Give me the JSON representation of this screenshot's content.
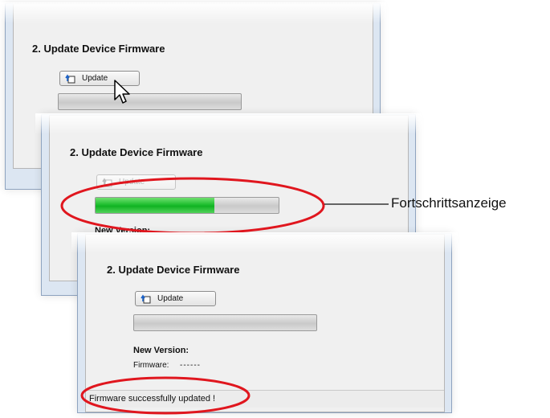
{
  "windows": [
    {
      "section_title": "2. Update Device Firmware",
      "update_label": "Update",
      "progress_fraction": 0
    },
    {
      "section_title": "2. Update Device Firmware",
      "update_label": "Update",
      "progress_fraction": 0.65,
      "new_version_label": "New Version:"
    },
    {
      "section_title": "2. Update Device Firmware",
      "update_label": "Update",
      "progress_fraction": 0,
      "new_version_label": "New Version:",
      "firmware_label": "Firmware:",
      "firmware_value": "------",
      "status_message": "Firmware successfully updated !"
    }
  ],
  "annotations": {
    "progress_callout": "Fortschrittsanzeige",
    "highlight_color": "#e0161e"
  },
  "colors": {
    "progress_fill": "#1fbf2f",
    "window_frame": "#dce6f2"
  }
}
